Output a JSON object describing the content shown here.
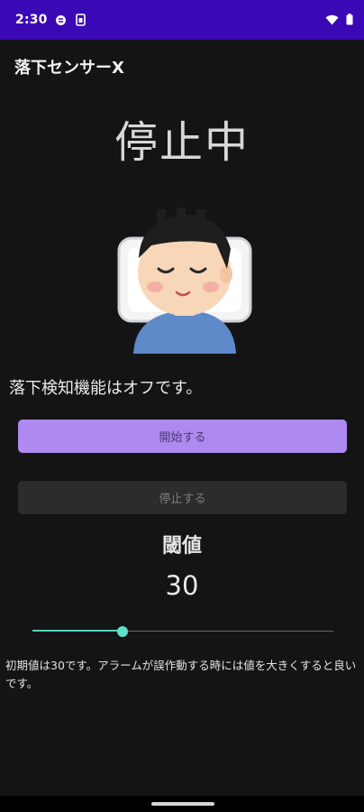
{
  "status_bar": {
    "time": "2:30",
    "icons": [
      "sync-icon",
      "sim-icon",
      "wifi-icon",
      "battery-icon"
    ],
    "background": "#3b08b5"
  },
  "app": {
    "title": "落下センサーX"
  },
  "main": {
    "state_title": "停止中",
    "illustration": "sleeping-person-illustration",
    "status_text": "落下検知機能はオフです。",
    "start_button_label": "開始する",
    "stop_button_label": "停止する",
    "threshold_label": "閾値",
    "threshold_value": "30",
    "slider_fraction": 0.3,
    "hint_text": "初期値は30です。アラームが誤作動する時には値を大きくすると良いです。"
  },
  "colors": {
    "accent": "#ad89f0",
    "slider": "#56d2bf",
    "background": "#141414"
  }
}
